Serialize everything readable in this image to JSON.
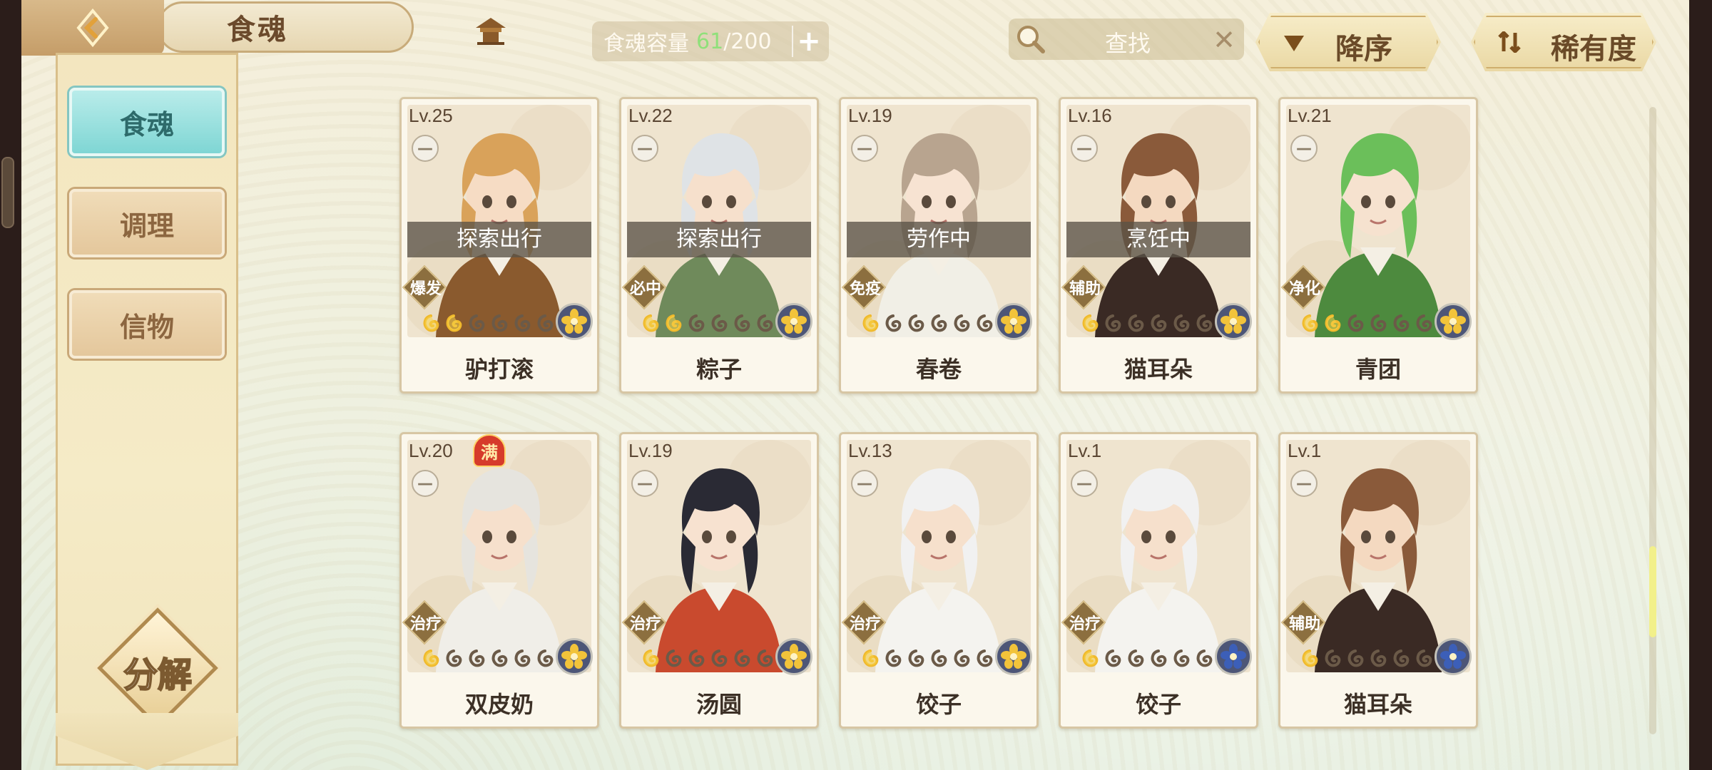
{
  "header": {
    "title": "食魂",
    "capacity_label": "食魂容量",
    "capacity_count": "61",
    "capacity_total": "/200",
    "search_label": "查找",
    "sort_order_label": "降序",
    "sort_by_label": "稀有度"
  },
  "sidebar": {
    "tabs": [
      {
        "label": "食魂",
        "active": true
      },
      {
        "label": "调理",
        "active": false
      },
      {
        "label": "信物",
        "active": false
      }
    ],
    "decompose_label": "分解"
  },
  "colors": {
    "accent_teal": "#7fd6d4",
    "capacity_green": "#8fe07a",
    "card_border": "#d7c6a4",
    "status_overlay": "#5a5246"
  },
  "cards": [
    {
      "level": "Lv.25",
      "status": "探索出行",
      "role": "爆发",
      "stars_lit": 2,
      "stars_total": 6,
      "element": "gold",
      "name": "驴打滚",
      "hair": "#d9a25a",
      "skin": "#f6dcc4",
      "robe": "#8a5a2e"
    },
    {
      "level": "Lv.22",
      "status": "探索出行",
      "role": "必中",
      "stars_lit": 2,
      "stars_total": 6,
      "element": "gold",
      "name": "粽子",
      "hair": "#dfe3e6",
      "skin": "#f6e0cc",
      "robe": "#6f8a5b"
    },
    {
      "level": "Lv.19",
      "status": "劳作中",
      "role": "免疫",
      "stars_lit": 1,
      "stars_total": 6,
      "element": "gold",
      "name": "春卷",
      "hair": "#b8a48f",
      "skin": "#f7e3d2",
      "robe": "#f1efe6"
    },
    {
      "level": "Lv.16",
      "status": "烹饪中",
      "role": "辅助",
      "stars_lit": 1,
      "stars_total": 6,
      "element": "gold",
      "name": "猫耳朵",
      "hair": "#8a5a3a",
      "skin": "#f4d9c0",
      "robe": "#3a2a24"
    },
    {
      "level": "Lv.21",
      "status": "",
      "role": "净化",
      "stars_lit": 2,
      "stars_total": 6,
      "element": "gold",
      "name": "青团",
      "hair": "#6bbf5a",
      "skin": "#f6e2cf",
      "robe": "#4d8a3e"
    },
    {
      "level": "Lv.20",
      "status": "",
      "role": "治疗",
      "stars_lit": 1,
      "stars_total": 6,
      "element": "gold",
      "name": "双皮奶",
      "hair": "#e6e4de",
      "skin": "#f6e0cc",
      "robe": "#f0eee8",
      "full_badge": "满"
    },
    {
      "level": "Lv.19",
      "status": "",
      "role": "治疗",
      "stars_lit": 1,
      "stars_total": 6,
      "element": "gold",
      "name": "汤圆",
      "hair": "#2a2a34",
      "skin": "#f7e2d0",
      "robe": "#c94a2e"
    },
    {
      "level": "Lv.13",
      "status": "",
      "role": "治疗",
      "stars_lit": 1,
      "stars_total": 6,
      "element": "gold",
      "name": "饺子",
      "hair": "#f1f1f1",
      "skin": "#f6e0cc",
      "robe": "#f4f3ef"
    },
    {
      "level": "Lv.1",
      "status": "",
      "role": "治疗",
      "stars_lit": 1,
      "stars_total": 6,
      "element": "blue",
      "name": "饺子",
      "hair": "#f1f1f1",
      "skin": "#f6e0cc",
      "robe": "#f4f3ef"
    },
    {
      "level": "Lv.1",
      "status": "",
      "role": "辅助",
      "stars_lit": 1,
      "stars_total": 6,
      "element": "blue",
      "name": "猫耳朵",
      "hair": "#8a5a3a",
      "skin": "#f4d9c0",
      "robe": "#3a2a24"
    }
  ]
}
